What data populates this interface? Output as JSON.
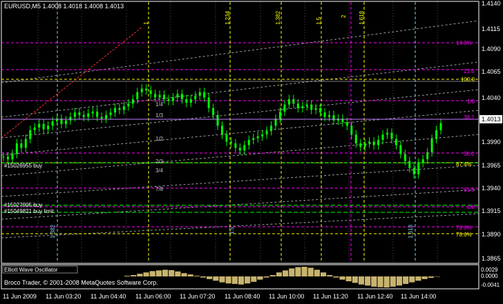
{
  "window": {
    "title": "EURUSD,M5  1.4008 1.4018 1.4008 1.4013"
  },
  "price_axis": {
    "labels": [
      "1.4140",
      "1.4115",
      "1.4090",
      "1.4065",
      "1.4040",
      "1.4013",
      "1.3990",
      "1.3965",
      "1.3940",
      "1.3915",
      "1.3890",
      "1.3865"
    ],
    "current_price": "1.4013"
  },
  "indicator_axis": {
    "labels": [
      "0.0029",
      "0.0000",
      "-0.0041"
    ]
  },
  "time_axis": {
    "labels": [
      "11 Jun 2009",
      "11 Jun 03:20",
      "11 Jun 04:40",
      "11 Jun 06:00",
      "11 Jun 07:20",
      "11 Jun 08:40",
      "11 Jun 10:00",
      "11 Jun 11:20",
      "11 Jun 12:40",
      "11 Jun 14:00"
    ]
  },
  "fib_time_labels": {
    "top": [
      "1",
      "1.234",
      "1.382",
      "1.5",
      "2",
      "1.618"
    ],
    "bottom": [
      "1.382",
      "1.5",
      "1.618"
    ]
  },
  "fib_level_labels": [
    "14.6%",
    "23.6",
    "100.0",
    "1/0",
    "38.2",
    "50.0",
    "87.4%",
    "61.8",
    "2/0",
    "78.6%",
    "78.6%"
  ],
  "fan_labels": [
    "1/4",
    "1/3",
    "1/2",
    "2/3",
    "3/4",
    "7/8"
  ],
  "orders": [
    "#15026955 buy",
    "#15027905 buy",
    "#15049821 buy limit"
  ],
  "indicator": {
    "name": "Elliott Wave Oscillator"
  },
  "copyright": "Broco Trader, © 2001-2008 MetaQuotes Software Corp.",
  "colors": {
    "background": "#000000",
    "candle": "#00ff00",
    "axis": "#ffffff",
    "fib_time": "#87ceeb",
    "fib_level": "#ff00ff",
    "fan": "#ffff00",
    "order_line": "#00ff00",
    "oscillator": "#c8b46e"
  },
  "chart_data": {
    "type": "candlestick",
    "symbol": "EURUSD",
    "timeframe": "M5",
    "ylim": [
      1.3855,
      1.415
    ],
    "last_price": 1.4013,
    "ohlc_last": [
      1.4008,
      1.4018,
      1.4008,
      1.4013
    ],
    "close_series": [
      1.3975,
      1.3972,
      1.3978,
      1.399,
      1.3985,
      1.3995,
      1.4005,
      1.4008,
      1.4012,
      1.4006,
      1.401,
      1.4015,
      1.4018,
      1.4012,
      1.4016,
      1.402,
      1.4025,
      1.4022,
      1.402,
      1.4024,
      1.4026,
      1.402,
      1.4018,
      1.4022,
      1.4025,
      1.403,
      1.4028,
      1.4032,
      1.4035,
      1.404,
      1.4048,
      1.4052,
      1.405,
      1.4046,
      1.4042,
      1.4045,
      1.404,
      1.4038,
      1.4042,
      1.4046,
      1.404,
      1.4036,
      1.404,
      1.4044,
      1.4048,
      1.4042,
      1.403,
      1.4022,
      1.401,
      1.4,
      1.3992,
      1.399,
      1.3985,
      1.3982,
      1.3988,
      1.3994,
      1.3996,
      1.3998,
      1.4,
      1.4004,
      1.401,
      1.4018,
      1.4026,
      1.4034,
      1.404,
      1.4035,
      1.403,
      1.4032,
      1.4034,
      1.4028,
      1.403,
      1.4025,
      1.402,
      1.4022,
      1.4016,
      1.4018,
      1.4014,
      1.401,
      1.4,
      1.399,
      1.3986,
      1.399,
      1.3992,
      1.3988,
      1.3994,
      1.4,
      1.4002,
      1.3995,
      1.3988,
      1.3978,
      1.397,
      1.3962,
      1.3955,
      1.3968,
      1.3972,
      1.398,
      1.3995,
      1.4005,
      1.4013
    ],
    "oscillator_values": [
      0.0002,
      0.0004,
      0.0008,
      0.0012,
      0.0016,
      0.0018,
      0.002,
      0.0019,
      0.0015,
      0.001,
      0.0006,
      0.0002,
      -0.0004,
      -0.001,
      -0.0016,
      -0.0022,
      -0.0026,
      -0.0028,
      -0.003,
      -0.0026,
      -0.002,
      -0.0012,
      -0.0004,
      0.0004,
      0.0012,
      0.0018,
      0.0024,
      0.0028,
      0.0029,
      0.0026,
      0.002,
      0.0012,
      0.0004,
      -0.0004,
      -0.0012,
      -0.0018,
      -0.0024,
      -0.003,
      -0.0034,
      -0.0038,
      -0.004,
      -0.0041,
      -0.0038,
      -0.0034,
      -0.0028,
      -0.0022,
      -0.0016,
      -0.001,
      -0.0005,
      0.0
    ],
    "indicator_ylim": [
      -0.0041,
      0.0029
    ],
    "orders": [
      {
        "label": "#15026955 buy",
        "price": 1.3968
      },
      {
        "label": "#15027905 buy",
        "price": 1.392
      },
      {
        "label": "#15049821 buy limit",
        "price": 1.3912
      }
    ]
  }
}
